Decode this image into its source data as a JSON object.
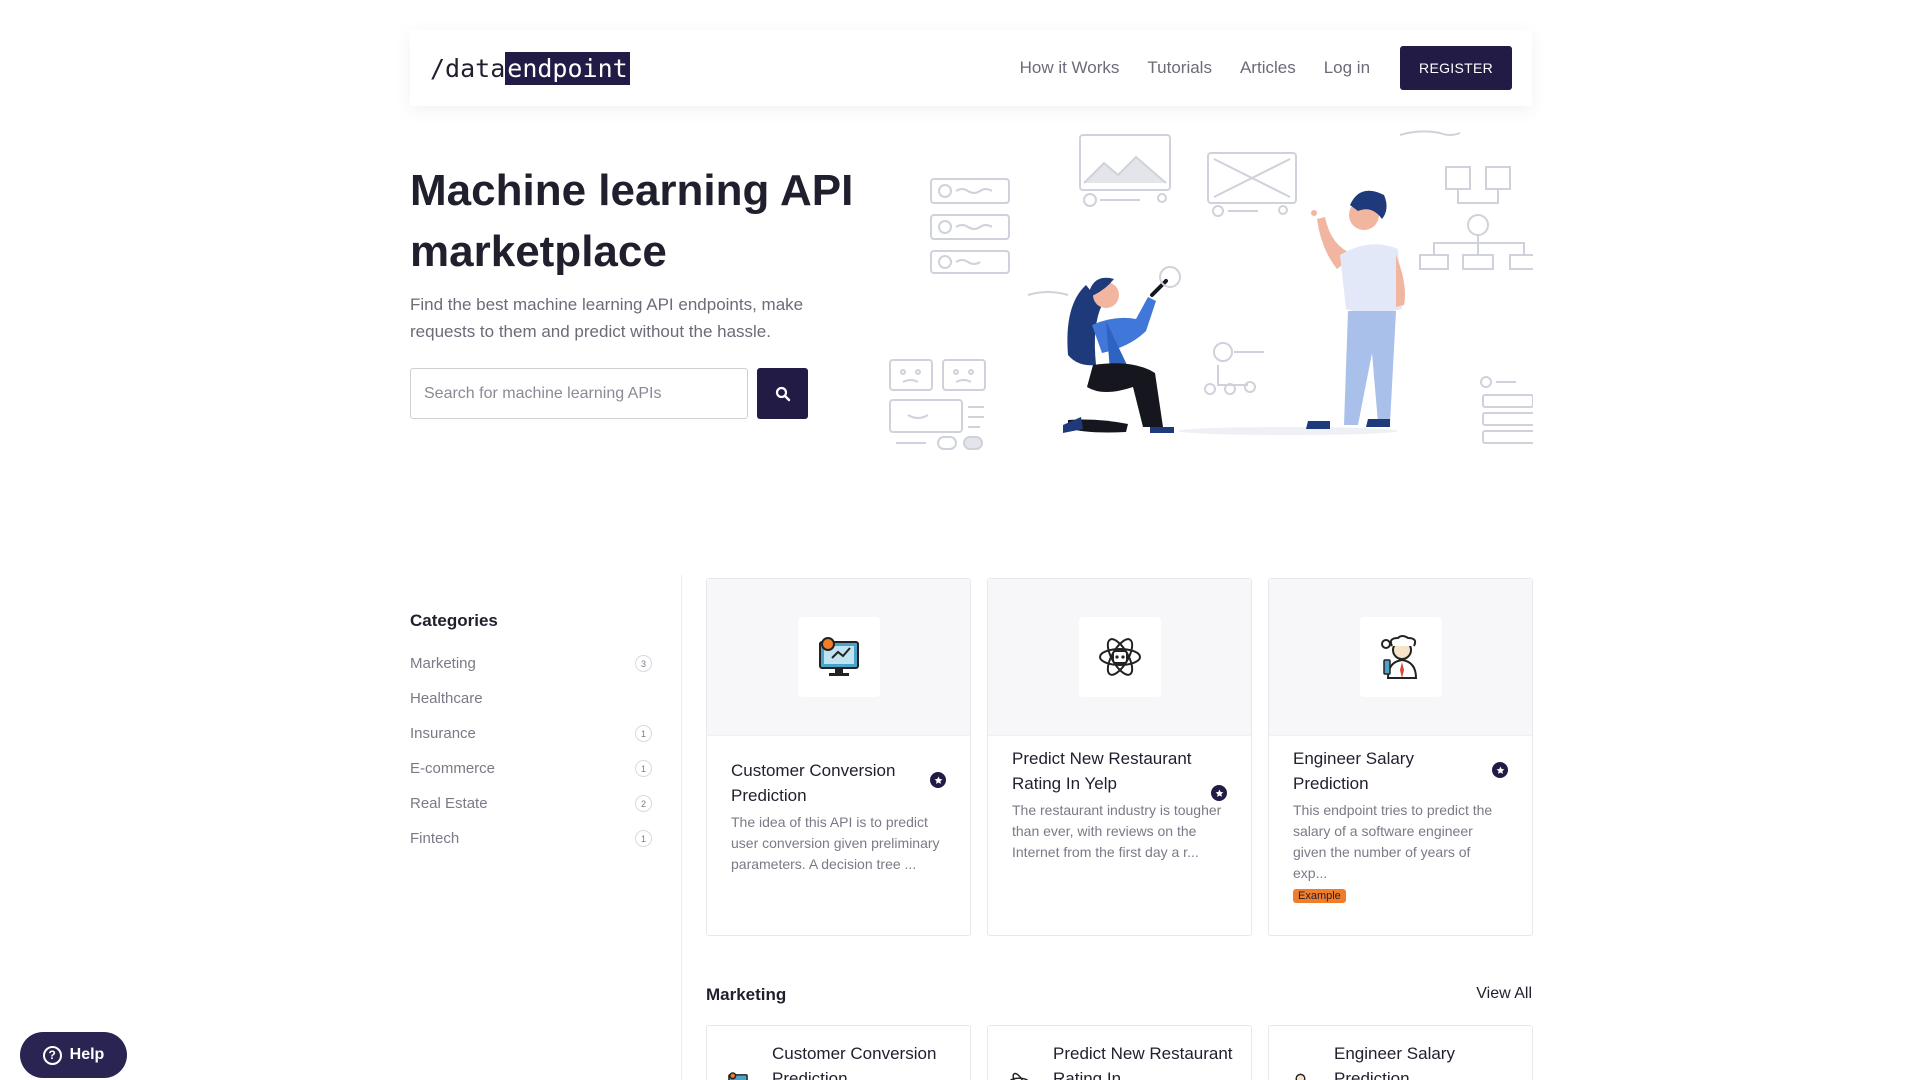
{
  "brand": {
    "logo_prefix": "/data",
    "logo_highlight": "endpoint",
    "accent": "#221b45",
    "badge_color": "#f07d2a"
  },
  "nav": {
    "links": [
      "How it Works",
      "Tutorials",
      "Articles",
      "Log in"
    ],
    "register_label": "REGISTER"
  },
  "hero": {
    "title": "Machine learning API marketplace",
    "subtitle": "Find the best machine learning API endpoints, make requests to them and predict without the hassle.",
    "search_placeholder": "Search for machine learning APIs",
    "search_icon": "search-icon"
  },
  "categories": {
    "title": "Categories",
    "items": [
      {
        "label": "Marketing",
        "count": "3"
      },
      {
        "label": "Healthcare",
        "count": ""
      },
      {
        "label": "Insurance",
        "count": "1"
      },
      {
        "label": "E-commerce",
        "count": "1"
      },
      {
        "label": "Real Estate",
        "count": "2"
      },
      {
        "label": "Fintech",
        "count": "1"
      }
    ]
  },
  "featured": [
    {
      "title": "Customer Conversion Prediction",
      "desc": "The idea of this API is to predict user conversion given preliminary parameters. A decision tree ...",
      "icon": "monitor-analytics-icon",
      "badge": ""
    },
    {
      "title": "Predict New Restaurant Rating In Yelp",
      "desc": "The restaurant industry is tougher than ever, with reviews on the Internet from the first day a r...",
      "icon": "atom-robot-icon",
      "badge": ""
    },
    {
      "title": "Engineer Salary Prediction",
      "desc": "This endpoint tries to predict the salary of a software engineer given the number of years of exp...",
      "icon": "engineer-icon",
      "badge": "Example"
    }
  ],
  "marketing": {
    "title": "Marketing",
    "view_all": "View All",
    "items": [
      {
        "title": "Customer Conversion Prediction"
      },
      {
        "title": "Predict New Restaurant Rating In"
      },
      {
        "title": "Engineer Salary Prediction"
      }
    ]
  },
  "help": {
    "label": "Help",
    "icon": "question-icon"
  }
}
